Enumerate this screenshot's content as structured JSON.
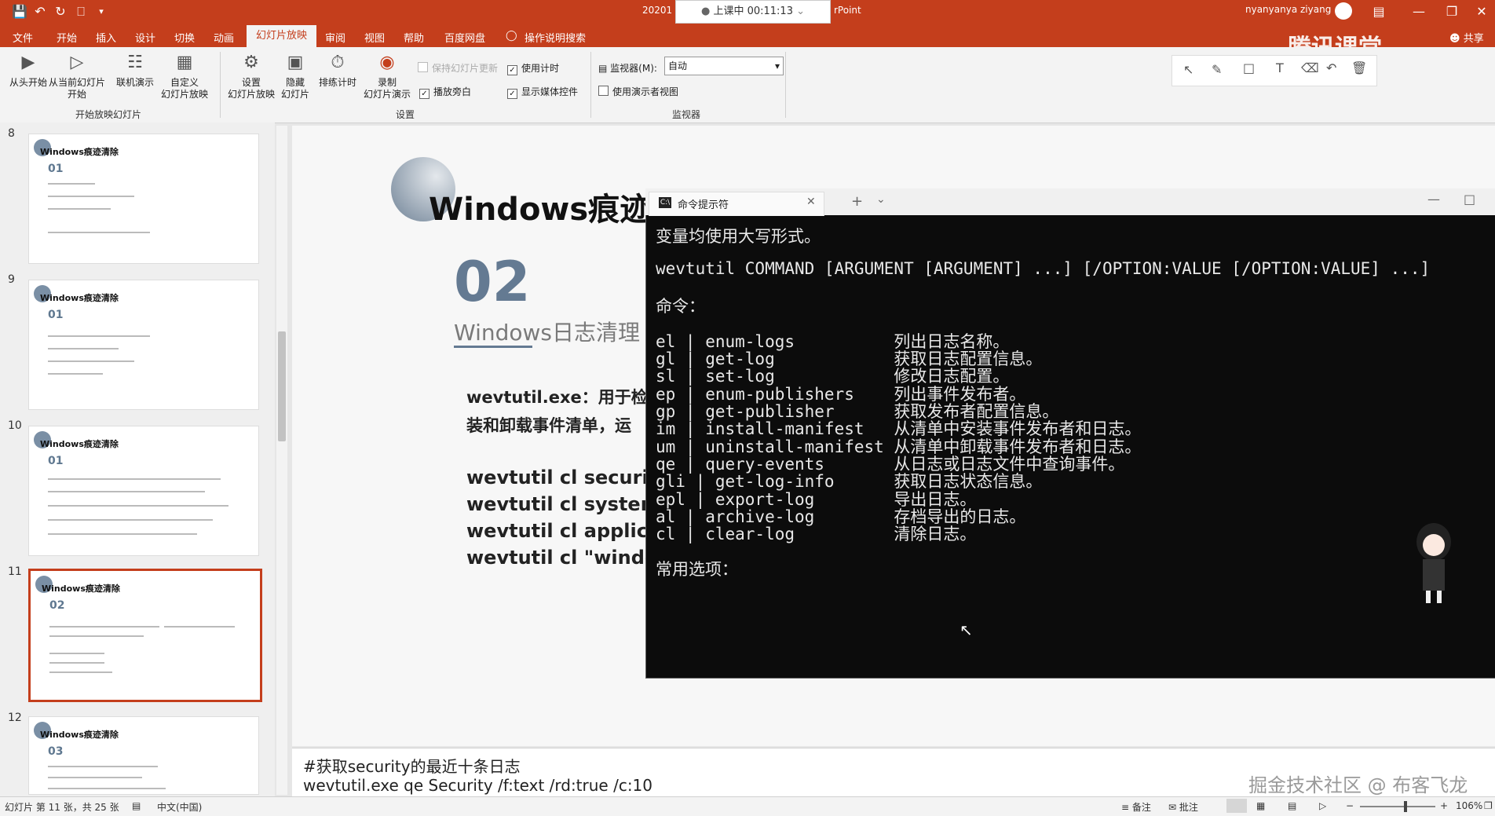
{
  "titlebar": {
    "doc_title_left": "20201",
    "doc_title_right": "rPoint",
    "timer": "上课中 00:11:13",
    "user": "nyanyanya ziyang"
  },
  "tabs": [
    "文件",
    "开始",
    "插入",
    "设计",
    "切换",
    "动画",
    "幻灯片放映",
    "审阅",
    "视图",
    "帮助",
    "百度网盘",
    "操作说明搜索"
  ],
  "share_label": "共享",
  "ribbon": {
    "buttons": [
      {
        "label": "从头开始"
      },
      {
        "label": "从当前幻灯片\n开始"
      },
      {
        "label": "联机演示"
      },
      {
        "label": "自定义\n幻灯片放映"
      },
      {
        "label": "设置\n幻灯片放映"
      },
      {
        "label": "隐藏\n幻灯片"
      },
      {
        "label": "排练计时"
      },
      {
        "label": "录制\n幻灯片演示"
      }
    ],
    "group_start": "开始放映幻灯片",
    "group_settings": "设置",
    "group_monitor": "监视器",
    "chk_play_narr": "播放旁白",
    "chk_use_timing": "使用计时",
    "chk_show_media": "显示媒体控件",
    "monitor_label": "监视器(M):",
    "monitor_value": "自动",
    "chk_presenter": "使用演示者视图",
    "faded_chk": "保持幻灯片更新"
  },
  "thumbs": [
    {
      "num": "8",
      "title": "Windows痕迹清除",
      "sec": "01"
    },
    {
      "num": "9",
      "title": "Windows痕迹清除",
      "sec": "01"
    },
    {
      "num": "10",
      "title": "Windows痕迹清除",
      "sec": "01"
    },
    {
      "num": "11",
      "title": "Windows痕迹清除",
      "sec": "02"
    },
    {
      "num": "12",
      "title": "Windows痕迹清除",
      "sec": "03"
    }
  ],
  "slide": {
    "title": "Windows痕迹清",
    "section_num": "02",
    "section_title": "Windows日志清理",
    "desc1": "wevtutil.exe：用于检",
    "desc2": "装和卸载事件清单，运",
    "cmds": [
      "wevtutil cl security",
      "wevtutil cl system",
      "wevtutil cl applicatio",
      "wevtutil cl \"windows"
    ]
  },
  "notes": {
    "line1": "#获取security的最近十条日志",
    "line2": "wevtutil.exe qe Security /f:text /rd:true /c:10"
  },
  "cmd": {
    "tab_title": "命令提示符",
    "lines": [
      "变量均使用大写形式。",
      "",
      "wevtutil COMMAND [ARGUMENT [ARGUMENT] ...] [/OPTION:VALUE [/OPTION:VALUE] ...]",
      "",
      "命令：",
      "",
      "el | enum-logs          列出日志名称。",
      "gl | get-log            获取日志配置信息。",
      "sl | set-log            修改日志配置。",
      "ep | enum-publishers    列出事件发布者。",
      "gp | get-publisher      获取发布者配置信息。",
      "im | install-manifest   从清单中安装事件发布者和日志。",
      "um | uninstall-manifest 从清单中卸载事件发布者和日志。",
      "qe | query-events       从日志或日志文件中查询事件。",
      "gli | get-log-info      获取日志状态信息。",
      "epl | export-log        导出日志。",
      "al | archive-log        存档导出的日志。",
      "cl | clear-log          清除日志。",
      "",
      "常用选项："
    ]
  },
  "status": {
    "slide_info": "幻灯片 第 11 张，共 25 张",
    "lang": "中文(中国)",
    "notes_btn": "备注",
    "comments_btn": "批注",
    "zoom": "106%"
  },
  "watermark_top": "腾讯课堂",
  "watermark_bottom": "掘金技术社区 @ 布客飞龙"
}
